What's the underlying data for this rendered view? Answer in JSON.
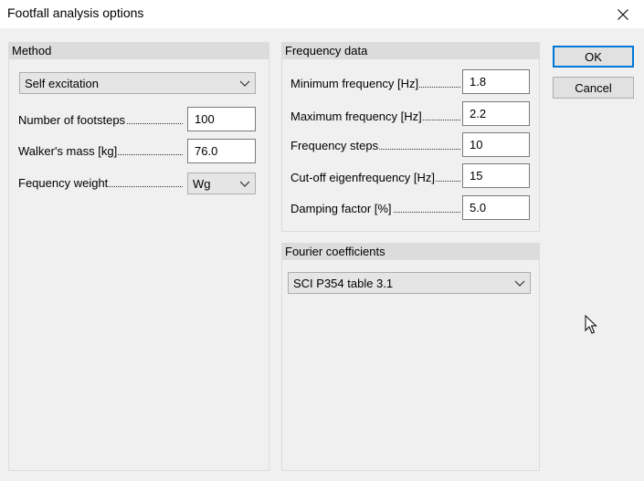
{
  "window": {
    "title": "Footfall analysis options",
    "close_icon": "close-icon"
  },
  "method": {
    "header": "Method",
    "excitation_select": "Self excitation",
    "fields": [
      {
        "label": "Number of footsteps",
        "value": "100"
      },
      {
        "label": "Walker's mass [kg]",
        "value": "76.0"
      }
    ],
    "weight": {
      "label": "Fequency weight",
      "value": "Wg"
    }
  },
  "frequency": {
    "header": "Frequency data",
    "fields": [
      {
        "label": "Minimum frequency [Hz]",
        "value": "1.8"
      },
      {
        "label": "Maximum frequency [Hz]",
        "value": "2.2"
      },
      {
        "label": "Frequency steps",
        "value": "10"
      },
      {
        "label": "Cut-off eigenfrequency [Hz]",
        "value": "15"
      },
      {
        "label": "Damping factor [%]",
        "value": "5.0"
      }
    ]
  },
  "fourier": {
    "header": "Fourier coefficients",
    "select": "SCI P354 table 3.1"
  },
  "buttons": {
    "ok": "OK",
    "cancel": "Cancel"
  }
}
